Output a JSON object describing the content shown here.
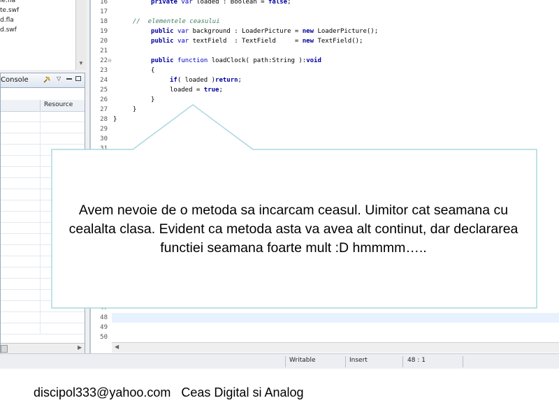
{
  "file_tree": {
    "items": [
      "le.fla",
      "te.swf",
      "d.fla",
      "d.swf"
    ]
  },
  "console": {
    "tab_label": "Console",
    "column_resource": "Resource"
  },
  "editor": {
    "line_numbers": [
      "16",
      "17",
      "18",
      "19",
      "20",
      "21",
      "22",
      "23",
      "24",
      "25",
      "26",
      "27",
      "28",
      "29",
      "30",
      "31",
      "47",
      "48",
      "49",
      "50"
    ],
    "code": {
      "l16_kw1": "private",
      "l16_kw2": "var",
      "l16_text": " loaded : Boolean = ",
      "l16_kw3": "false",
      "l16_end": ";",
      "l18_comment": "//  elementele ceasului",
      "l19_kw1": "public",
      "l19_kw2": "var",
      "l19_text": " background : LoaderPicture = ",
      "l19_kw3": "new",
      "l19_end": " LoaderPicture();",
      "l20_kw1": "public",
      "l20_kw2": "var",
      "l20_text": " textField  : TextField     = ",
      "l20_kw3": "new",
      "l20_end": " TextField();",
      "l22_kw1": "public",
      "l22_kw2": "function",
      "l22_text": " loadClock( path:String ):",
      "l22_kw3": "void",
      "l23": "{",
      "l24_kw1": "if",
      "l24_text": "( loaded )",
      "l24_kw2": "return",
      "l24_end": ";",
      "l25_text": "loaded = ",
      "l25_kw": "true",
      "l25_end": ";",
      "l26": "}",
      "l27": "}",
      "l28": "}"
    }
  },
  "status_bar": {
    "mode": "Writable",
    "insert": "Insert",
    "position": "48 : 1"
  },
  "callout": {
    "text": "Avem nevoie de o metoda sa incarcam ceasul. Uimitor cat seamana cu cealalta clasa. Evident ca metoda asta va avea alt continut, dar declararea functiei seamana foarte mult :D hmmmm….."
  },
  "footer": {
    "email": "discipol333@yahoo.com",
    "title": "Ceas Digital si Analog"
  },
  "colors": {
    "keyword": "#0000a0",
    "comment": "#3f7f5f",
    "callout_border": "#a8d8e0",
    "current_line": "#e8f2fe"
  }
}
